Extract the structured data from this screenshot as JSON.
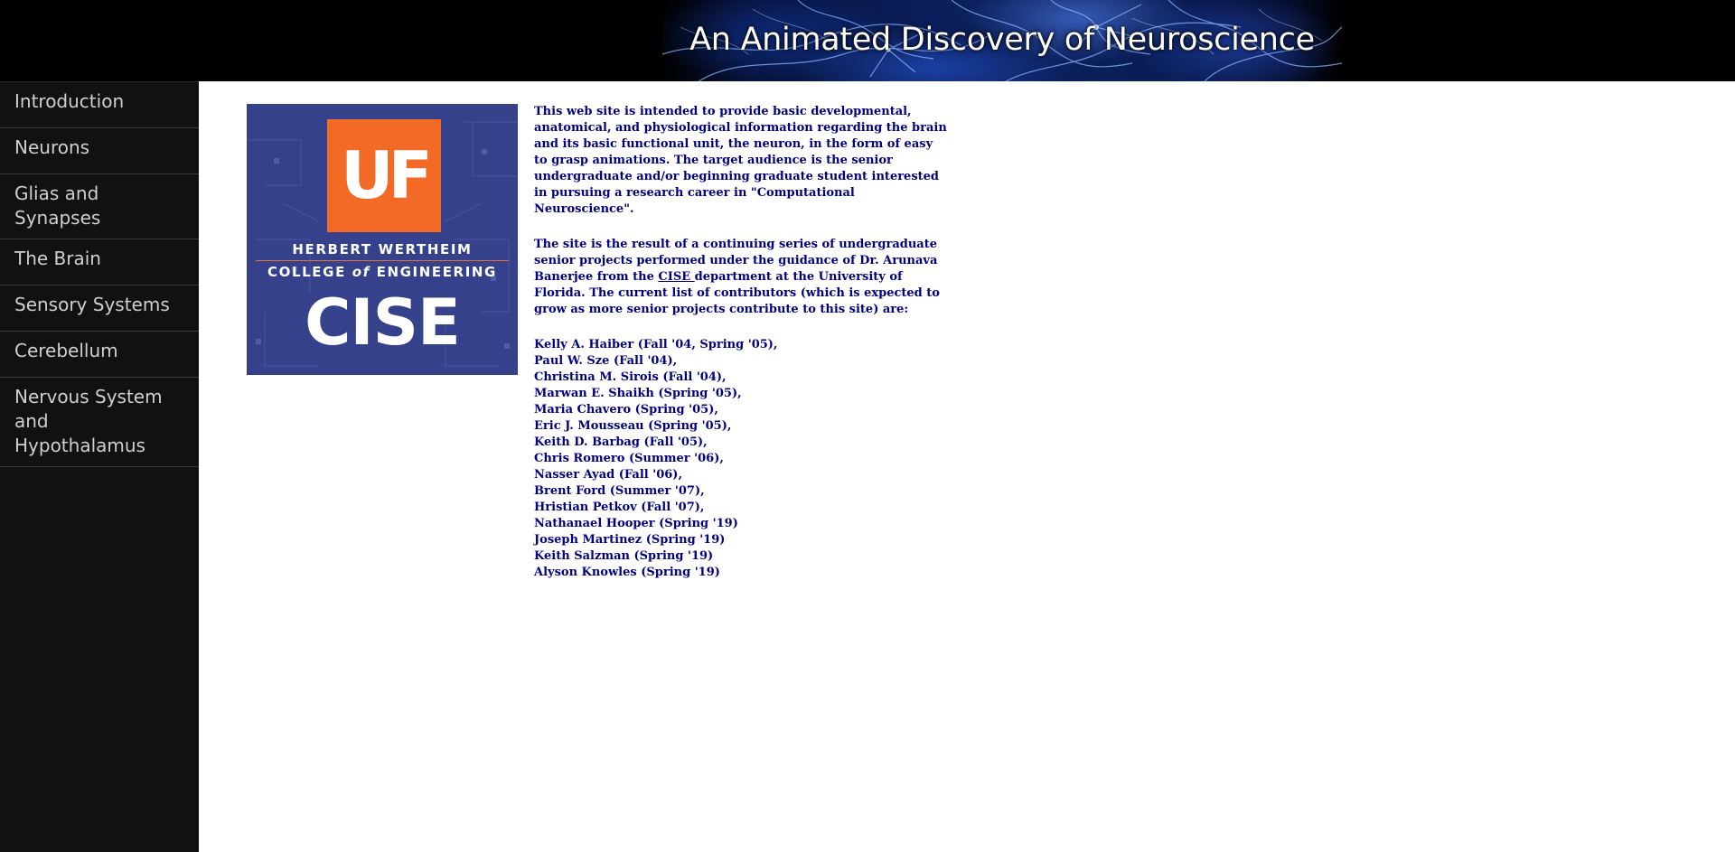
{
  "banner": {
    "title": "An Animated Discovery of Neuroscience"
  },
  "sidebar": {
    "items": [
      {
        "label": "Introduction"
      },
      {
        "label": "Neurons"
      },
      {
        "label": "Glias and Synapses"
      },
      {
        "label": "The Brain"
      },
      {
        "label": "Sensory Systems"
      },
      {
        "label": "Cerebellum"
      },
      {
        "label": "Nervous System and Hypothalamus"
      }
    ]
  },
  "logo": {
    "uf": "UF",
    "line1": "HERBERT WERTHEIM",
    "line2_pre": "COLLEGE ",
    "line2_of": "of",
    "line2_post": " ENGINEERING",
    "cise": "CISE",
    "colors": {
      "background": "#35418a",
      "uf_box": "#f26a25"
    }
  },
  "content": {
    "paragraph1": "This web site is intended to provide basic developmental, anatomical, and physiological information regarding the brain and its basic functional unit, the neuron, in the form of easy to grasp animations. The target audience is the senior undergraduate and/or beginning graduate student interested in pursuing a research career in \"Computational Neuroscience\".",
    "paragraph2_pre": "The site is the result of a continuing series of undergraduate senior projects performed under the guidance of Dr. Arunava Banerjee from the ",
    "paragraph2_link": "CISE ",
    "paragraph2_post": "department at the University of Florida. The current list of contributors (which is expected to grow as more senior projects contribute to this site) are:",
    "contributors": [
      "Kelly A. Haiber (Fall '04, Spring '05),",
      "Paul W. Sze (Fall '04),",
      "Christina M. Sirois (Fall '04),",
      "Marwan E. Shaikh (Spring '05),",
      "Maria Chavero (Spring '05),",
      "Eric J. Mousseau (Spring '05),",
      "Keith D. Barbag (Fall '05),",
      "Chris Romero (Summer '06),",
      "Nasser Ayad (Fall '06),",
      "Brent Ford (Summer '07),",
      "Hristian Petkov (Fall '07),",
      "Nathanael Hooper (Spring '19)",
      "Joseph Martinez (Spring '19)",
      "Keith Salzman (Spring '19)",
      "Alyson Knowles (Spring '19)"
    ],
    "text_color": "#000080"
  }
}
